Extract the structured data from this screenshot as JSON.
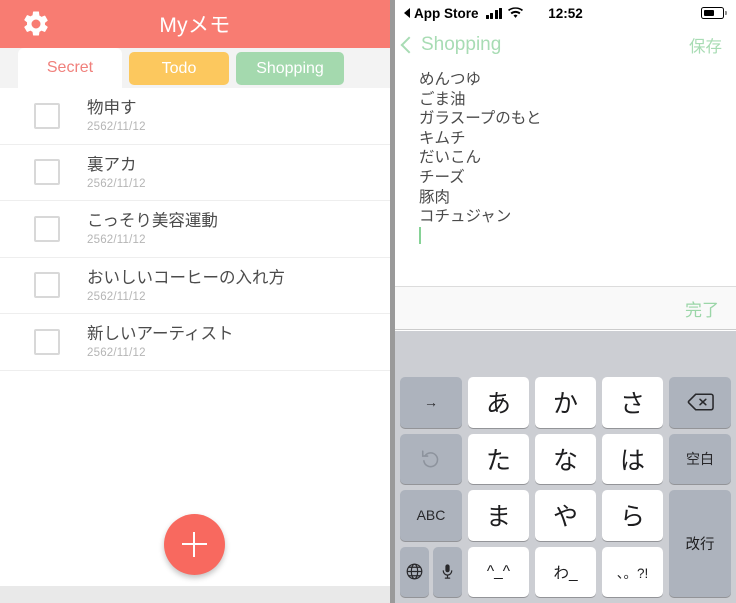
{
  "left_app": {
    "title": "Myメモ",
    "settings_icon": "gear-icon",
    "tabs": [
      {
        "label": "Secret",
        "active": true,
        "color": "#ffffff",
        "text_color": "#f0807c"
      },
      {
        "label": "Todo",
        "active": false,
        "color": "#fcc85e",
        "text_color": "#ffffff"
      },
      {
        "label": "Shopping",
        "active": false,
        "color": "#a4d9ae",
        "text_color": "#ffffff"
      }
    ],
    "memos": [
      {
        "title": "物申す",
        "date": "2562/11/12",
        "checked": false
      },
      {
        "title": "裏アカ",
        "date": "2562/11/12",
        "checked": false
      },
      {
        "title": "こっそり美容運動",
        "date": "2562/11/12",
        "checked": false
      },
      {
        "title": "おいしいコーヒーの入れ方",
        "date": "2562/11/12",
        "checked": false
      },
      {
        "title": "新しいアーティスト",
        "date": "2562/11/12",
        "checked": false
      }
    ],
    "fab": {
      "icon": "plus-icon",
      "color": "#f8695f"
    },
    "accent_color": "#f87c72"
  },
  "right_app": {
    "status_bar": {
      "back_label": "App Store",
      "time": "12:52",
      "signal_bars": 4,
      "wifi": "wifi-icon",
      "battery_percent": 55
    },
    "nav": {
      "back_label": "Shopping",
      "save_label": "保存",
      "tint_color": "#a8dcb4"
    },
    "editor": {
      "lines": [
        "めんつゆ",
        "ごま油",
        "ガラスープのもと",
        "キムチ",
        "だいこん",
        "チーズ",
        "豚肉",
        "コチュジャン"
      ],
      "caret_color": "#86d296"
    },
    "accessory_bar": {
      "done_label": "完了"
    },
    "keyboard": {
      "rows": [
        [
          {
            "label": "→",
            "type": "fn",
            "name": "cursor-right-key"
          },
          {
            "label": "あ",
            "type": "kana",
            "name": "key-a"
          },
          {
            "label": "か",
            "type": "kana",
            "name": "key-ka"
          },
          {
            "label": "さ",
            "type": "kana",
            "name": "key-sa"
          },
          {
            "label": "",
            "type": "fn",
            "name": "backspace-key"
          }
        ],
        [
          {
            "label": "",
            "type": "fn",
            "name": "undo-key"
          },
          {
            "label": "た",
            "type": "kana",
            "name": "key-ta"
          },
          {
            "label": "な",
            "type": "kana",
            "name": "key-na"
          },
          {
            "label": "は",
            "type": "kana",
            "name": "key-ha"
          },
          {
            "label": "空白",
            "type": "fn",
            "name": "space-key"
          }
        ],
        [
          {
            "label": "ABC",
            "type": "fn",
            "name": "abc-key"
          },
          {
            "label": "ま",
            "type": "kana",
            "name": "key-ma"
          },
          {
            "label": "や",
            "type": "kana",
            "name": "key-ya"
          },
          {
            "label": "ら",
            "type": "kana",
            "name": "key-ra"
          },
          {
            "label": "改行",
            "type": "fn",
            "name": "return-key"
          }
        ],
        [
          {
            "label": "",
            "type": "pair",
            "name": "globe-mic-keys"
          },
          {
            "label": "^_^",
            "type": "small",
            "name": "key-emoticon"
          },
          {
            "label": "わ_",
            "type": "small",
            "name": "key-wa"
          },
          {
            "label": "、。?!",
            "type": "tiny",
            "name": "key-punctuation"
          }
        ]
      ]
    }
  }
}
